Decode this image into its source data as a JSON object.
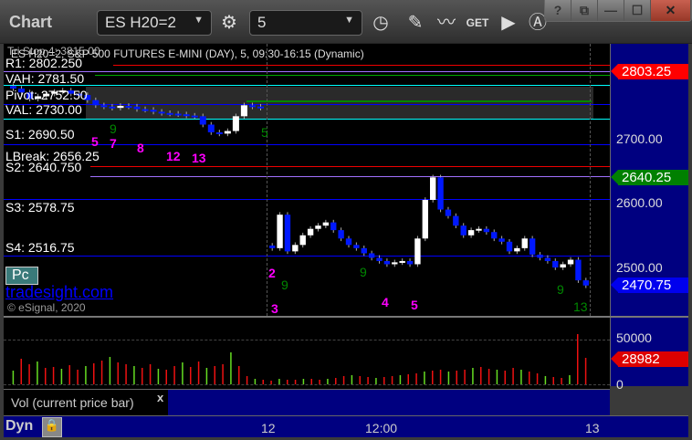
{
  "window": {
    "title": "Chart",
    "symbol": "ES H20=2",
    "interval": "5",
    "controls": [
      "?",
      "⧉",
      "—",
      "☐",
      "✕"
    ]
  },
  "chart": {
    "header": "ES H20=2, S&P 500 FUTURES E-MINI (DAY), 5, 09:30-16:15 (Dynamic)",
    "overlap_text": "Tri Stop 4: 3815.00",
    "levels": [
      {
        "label": "R1: 2802.250",
        "color": "#ff0000"
      },
      {
        "label": "VAH: 2781.50",
        "color": "#00aa00"
      },
      {
        "label": "Pivot: 2752.50",
        "color": "#0000ff"
      },
      {
        "label": "VAL: 2730.00",
        "color": "#00ffff"
      },
      {
        "label": "S1: 2690.50",
        "color": "#0000ff"
      },
      {
        "label": "LBreak: 2656.25",
        "color": "#ff0000"
      },
      {
        "label": "S2: 2640.750",
        "color": "#a070ff"
      },
      {
        "label": "S3: 2578.75",
        "color": "#0000ff"
      },
      {
        "label": "S4: 2516.75",
        "color": "#0000ff"
      }
    ],
    "counts_magenta": [
      "5",
      "7",
      "8",
      "12",
      "13",
      "2",
      "3",
      "4",
      "5"
    ],
    "counts_green": [
      "9",
      "5",
      "9",
      "9",
      "9",
      "13"
    ],
    "pc_button": "Pc",
    "watermark": "tradesight.com",
    "copyright": "© eSignal, 2020",
    "price_axis": [
      "2700.00",
      "2600.00",
      "2500.00"
    ],
    "price_tags": [
      {
        "value": "2803.25",
        "color": "#ff0000"
      },
      {
        "value": "2640.25",
        "color": "#008000"
      },
      {
        "value": "2470.75",
        "color": "#0000ff"
      }
    ],
    "closes": {
      "day1": [
        2778,
        2772,
        2762,
        2766,
        2770,
        2773,
        2775,
        2770,
        2768,
        2760,
        2752,
        2750,
        2748,
        2751,
        2750,
        2746,
        2745,
        2742,
        2740,
        2739,
        2738,
        2736,
        2735,
        2722,
        2710,
        2708,
        2712,
        2735,
        2752,
        2750,
        2748
      ],
      "day2": [
        2530,
        2582,
        2525,
        2535,
        2550,
        2560,
        2565,
        2570,
        2558,
        2545,
        2535,
        2530,
        2522,
        2515,
        2510,
        2505,
        2508,
        2510,
        2505,
        2545,
        2605,
        2640,
        2590,
        2580,
        2565,
        2550,
        2558,
        2560,
        2555,
        2545,
        2540,
        2525,
        2530,
        2545,
        2520,
        2515,
        2510,
        2500,
        2505,
        2512,
        2480,
        2472
      ]
    }
  },
  "volume": {
    "axis": [
      "50000",
      "0"
    ],
    "tag": "28982",
    "legend": "Vol (current price bar)",
    "close_label": "x",
    "values": [
      15000,
      28000,
      22000,
      25000,
      18000,
      19000,
      17000,
      21000,
      16000,
      20000,
      23000,
      26000,
      30000,
      24000,
      22000,
      20000,
      18000,
      22000,
      17000,
      16000,
      20000,
      24000,
      19000,
      25000,
      18000,
      20000,
      22000,
      35000,
      20000,
      9000,
      6000,
      5000,
      4000,
      6000,
      5000,
      5000,
      6000,
      6000,
      5000,
      6000,
      7000,
      9000,
      10000,
      9000,
      8000,
      7000,
      8000,
      9000,
      10000,
      11000,
      12000,
      14000,
      15000,
      16000,
      14000,
      15000,
      16000,
      18000,
      19000,
      17000,
      16000,
      15000,
      18000,
      16000,
      14000,
      12000,
      9000,
      8000,
      7000,
      10000,
      55000,
      29000
    ]
  },
  "time_axis": [
    "12",
    "12:00",
    "13"
  ],
  "footer": {
    "dyn": "Dyn"
  }
}
